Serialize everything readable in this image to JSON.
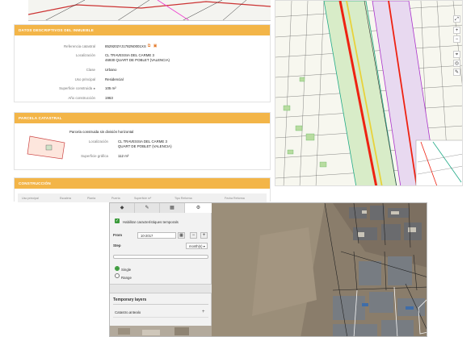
{
  "immueble": {
    "title": "DATOS DESCRIPTIVOS DEL INMUEBLE",
    "rows": [
      {
        "label": "Referencia catastral",
        "value": "8529202YJ1782N0001XS"
      },
      {
        "label": "Localización",
        "value": "CL TRAVESSIA DEL CARME 3",
        "value2": "46930 QUART DE POBLET (VALENCIA)"
      },
      {
        "label": "Clase",
        "value": "Urbano"
      },
      {
        "label": "Uso principal",
        "value": "Residencial"
      },
      {
        "label": "Superficie construida",
        "value": "105 m²"
      },
      {
        "label": "Año construcción",
        "value": "1963"
      }
    ]
  },
  "parcela": {
    "title": "PARCELA CATASTRAL",
    "subtitle": "Parcela construida sin división horizontal",
    "loc_label": "Localización",
    "loc_value": "CL TRAVESSIA DEL CARME 3",
    "loc_value2": "QUART DE POBLET (VALENCIA)",
    "sup_label": "Superficie gráfica",
    "sup_value": "112 m²"
  },
  "construccion": {
    "title": "CONSTRUCCIÓN",
    "columns": [
      "Uso principal",
      "Escalera",
      "Planta",
      "Puerta",
      "Superficie m²",
      "Tipo Reforma",
      "Fecha Reforma"
    ]
  },
  "map_controls": [
    "⤢",
    "+",
    "−",
    "⌖",
    "◎",
    "✎"
  ],
  "gis": {
    "tabs": [
      {
        "icon": "layers-icon",
        "glyph": "◆"
      },
      {
        "icon": "tag-icon",
        "glyph": "✎"
      },
      {
        "icon": "table-icon",
        "glyph": "▦"
      },
      {
        "icon": "settings-icon",
        "glyph": "⚙"
      }
    ],
    "enable_label": "Habilitar característiques temporals",
    "from_label": "From",
    "from_value": "10-2017",
    "step_label": "Step",
    "step_value": "month(s)",
    "single_label": "Single",
    "range_label": "Range",
    "temporary_layers": "Temporary layers",
    "layer_name": "Catastro.antealo"
  }
}
